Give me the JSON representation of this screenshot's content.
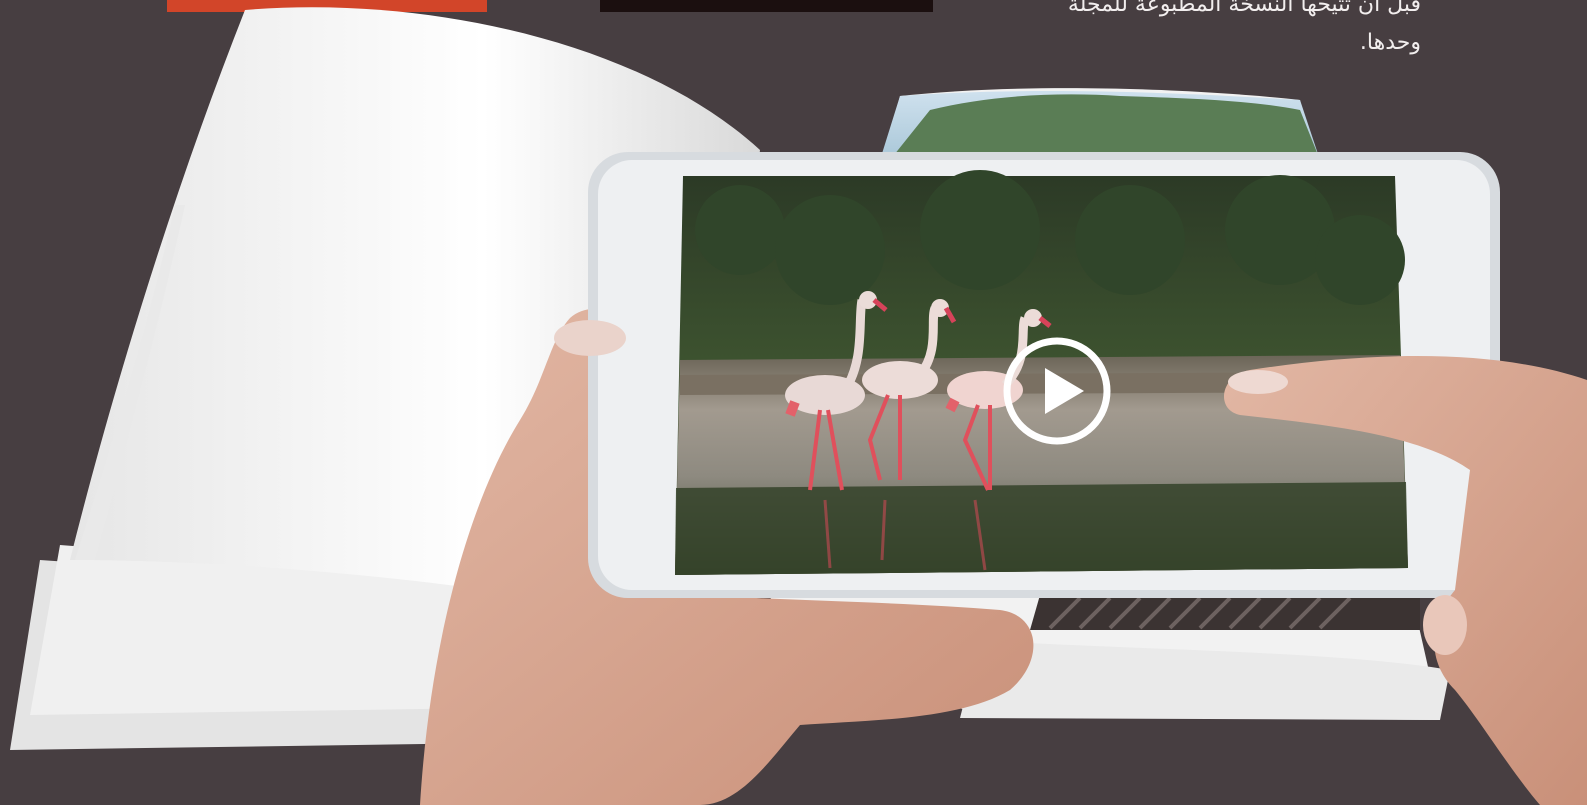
{
  "header": {
    "paragraph_line1": "قبل أن تتيحها النسخة المطبوعة للمجلة",
    "paragraph_line2": "وحدها."
  },
  "colors": {
    "background": "#473e41",
    "accent_red": "#d24529",
    "page_white": "#f4f4f4",
    "phone_white": "#e9ecef",
    "flamingo_pink": "#e8a3a6"
  },
  "icons": {
    "play": "play-icon"
  }
}
